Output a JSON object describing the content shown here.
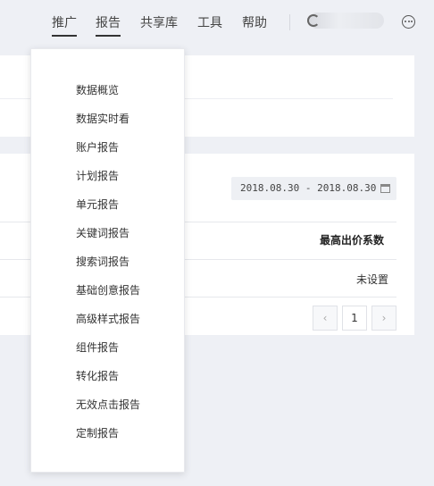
{
  "nav": {
    "items": [
      "推广",
      "报告",
      "共享库",
      "工具",
      "帮助"
    ]
  },
  "report": {
    "date_range": "2018.08.30 - 2018.08.30",
    "column_header": "最高出价系数",
    "cell_value": "未设置",
    "pagination": {
      "prev": "‹",
      "page": "1",
      "next": "›"
    }
  },
  "dropdown": {
    "items": [
      "数据概览",
      "数据实时看",
      "账户报告",
      "计划报告",
      "单元报告",
      "关键词报告",
      "搜索词报告",
      "基础创意报告",
      "高级样式报告",
      "组件报告",
      "转化报告",
      "无效点击报告",
      "定制报告"
    ]
  }
}
